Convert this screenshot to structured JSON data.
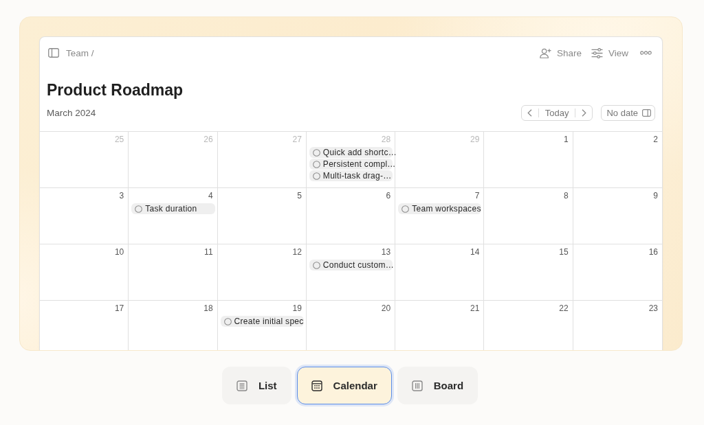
{
  "breadcrumb": "Team /",
  "header_actions": [
    {
      "kind": "share",
      "label": "Share"
    },
    {
      "kind": "view",
      "label": "View"
    },
    {
      "kind": "more"
    }
  ],
  "title": "Product Roadmap",
  "month": "March 2024",
  "navigation": {
    "today": "Today"
  },
  "no_date_button": "No date",
  "calendar": {
    "weeks": [
      {
        "days": [
          {
            "day": "25",
            "in_month": false
          },
          {
            "day": "26",
            "in_month": false
          },
          {
            "day": "27",
            "in_month": false
          },
          {
            "day": "28",
            "in_month": false,
            "tasks": [
              {
                "title": "Quick add shortc…",
                "completed": false
              },
              {
                "title": "Persistent compl…",
                "completed": false
              },
              {
                "title": "Multi-task drag-…",
                "completed": false
              }
            ]
          },
          {
            "day": "29",
            "in_month": false
          },
          {
            "day": "1",
            "in_month": true
          },
          {
            "day": "2",
            "in_month": true
          }
        ]
      },
      {
        "days": [
          {
            "day": "3",
            "in_month": true
          },
          {
            "day": "4",
            "in_month": true,
            "tasks": [
              {
                "title": "Task duration",
                "completed": false
              }
            ]
          },
          {
            "day": "5",
            "in_month": true
          },
          {
            "day": "6",
            "in_month": true
          },
          {
            "day": "7",
            "in_month": true,
            "tasks": [
              {
                "title": "Team workspaces",
                "completed": false
              }
            ]
          },
          {
            "day": "8",
            "in_month": true
          },
          {
            "day": "9",
            "in_month": true
          }
        ]
      },
      {
        "days": [
          {
            "day": "10",
            "in_month": true
          },
          {
            "day": "11",
            "in_month": true
          },
          {
            "day": "12",
            "in_month": true
          },
          {
            "day": "13",
            "in_month": true,
            "tasks": [
              {
                "title": "Conduct custom…",
                "completed": false
              }
            ]
          },
          {
            "day": "14",
            "in_month": true
          },
          {
            "day": "15",
            "in_month": true
          },
          {
            "day": "16",
            "in_month": true
          }
        ]
      },
      {
        "days": [
          {
            "day": "17",
            "in_month": true
          },
          {
            "day": "18",
            "in_month": true
          },
          {
            "day": "19",
            "in_month": true,
            "tasks": [
              {
                "title": "Create initial spec",
                "completed": false
              }
            ]
          },
          {
            "day": "20",
            "in_month": true
          },
          {
            "day": "21",
            "in_month": true
          },
          {
            "day": "22",
            "in_month": true
          },
          {
            "day": "23",
            "in_month": true
          }
        ]
      }
    ]
  },
  "views": [
    {
      "kind": "list",
      "label": "List",
      "selected": false
    },
    {
      "kind": "calendar",
      "label": "Calendar",
      "selected": true
    },
    {
      "kind": "board",
      "label": "Board",
      "selected": false
    }
  ]
}
